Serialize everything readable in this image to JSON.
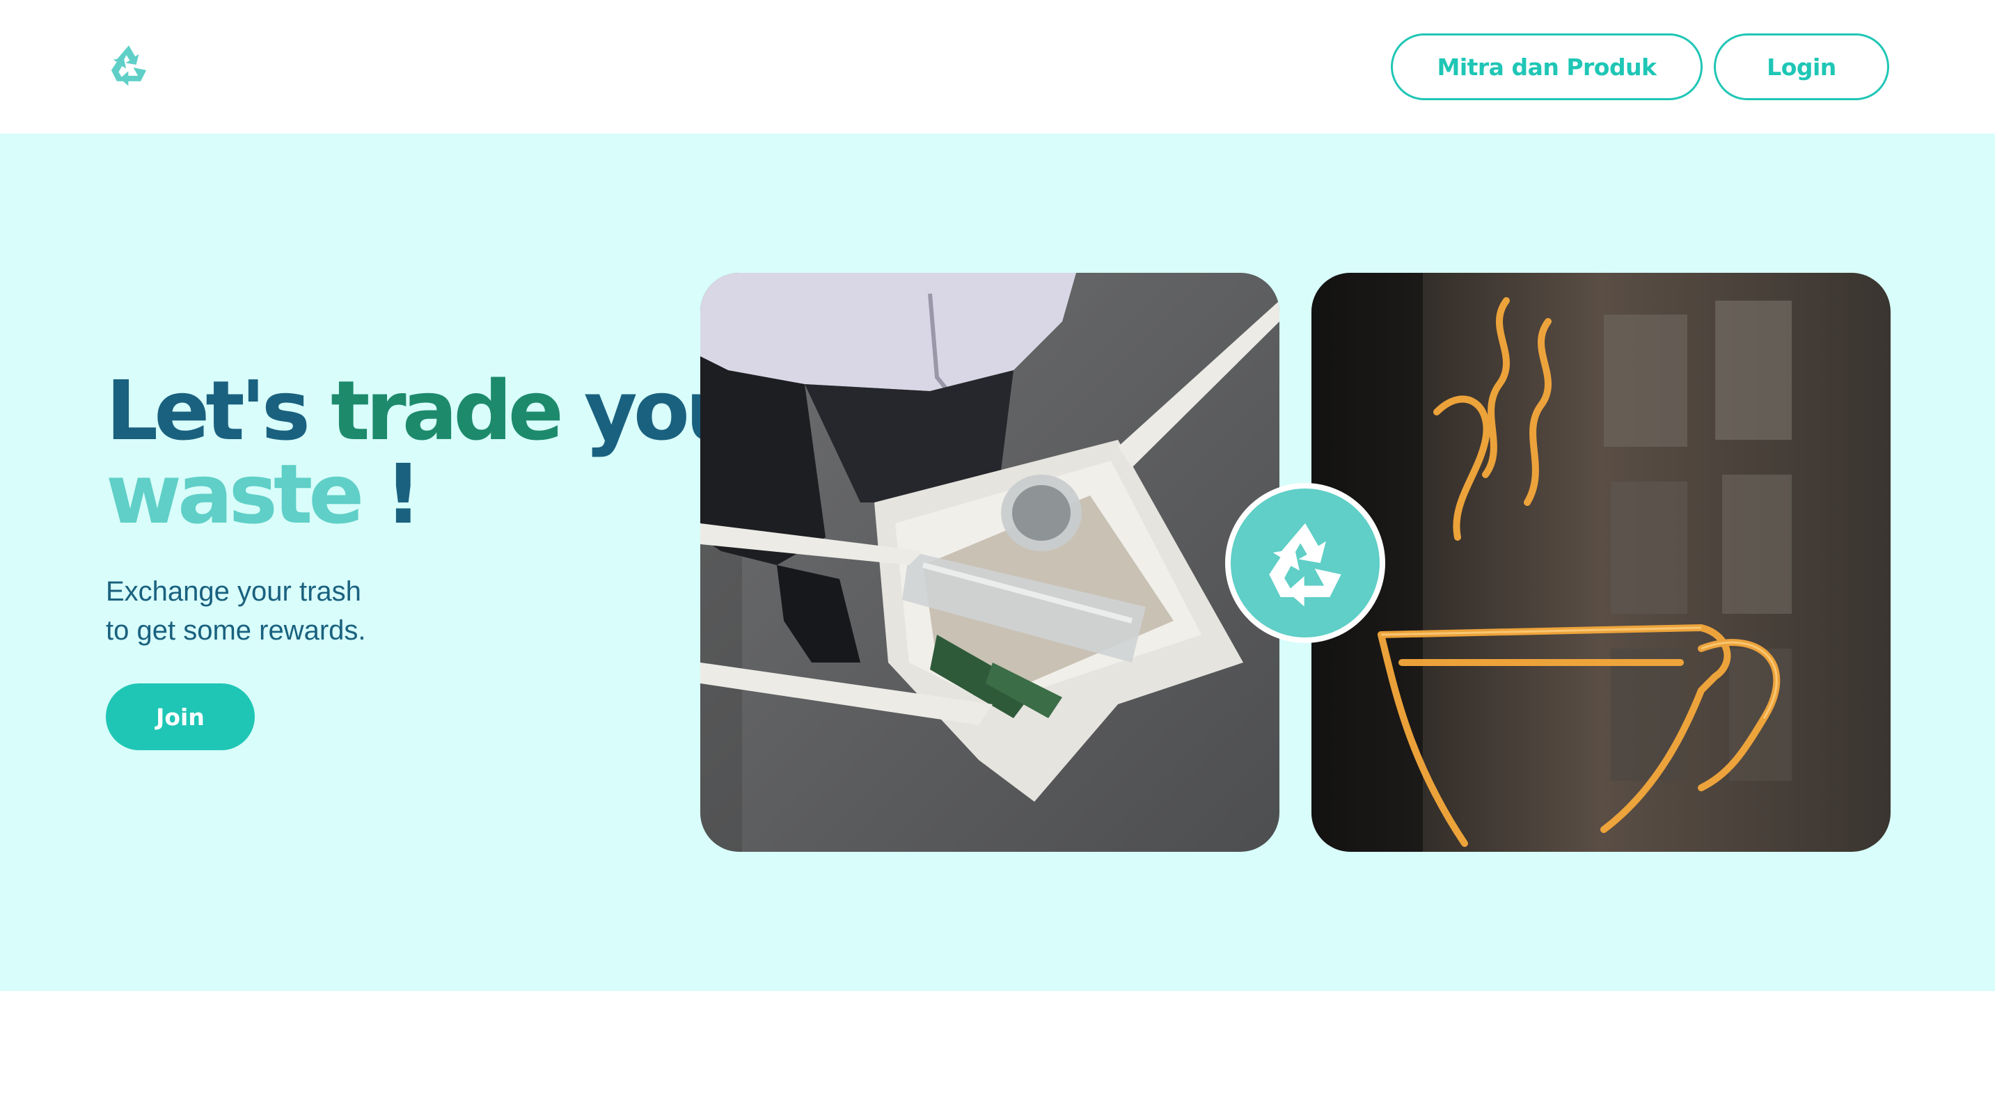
{
  "navbar": {
    "logo_icon": "recycle-icon",
    "partners_label": "Mitra dan Produk",
    "login_label": "Login"
  },
  "hero": {
    "headline_word_1": "Let's",
    "headline_word_2": "trade",
    "headline_word_3": "your",
    "headline_word_4": "waste",
    "headline_word_5": "!",
    "subtitle_line_1": "Exchange your trash",
    "subtitle_line_2": "to get some rewards.",
    "join_label": "Join",
    "badge_icon": "recycle-icon"
  },
  "colors": {
    "accent": "#1fc6b5",
    "hero_background": "#d8fdfa",
    "headline_dark": "#1a617f",
    "headline_green": "#1d8a6c",
    "headline_light": "#5fcfc7"
  }
}
